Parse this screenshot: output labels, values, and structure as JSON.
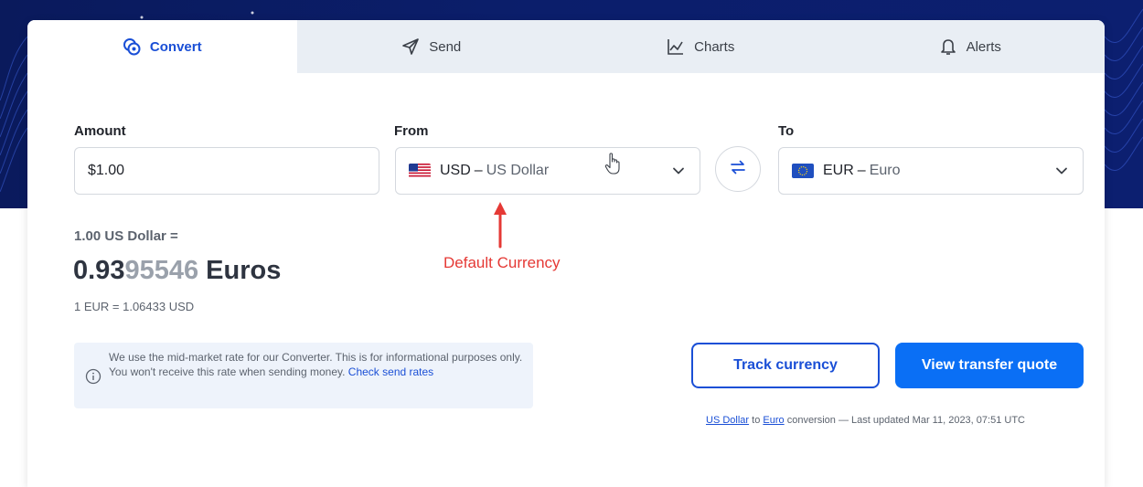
{
  "tabs": [
    {
      "label": "Convert",
      "icon": "coins-icon",
      "active": true
    },
    {
      "label": "Send",
      "icon": "paper-plane-icon",
      "active": false
    },
    {
      "label": "Charts",
      "icon": "line-chart-icon",
      "active": false
    },
    {
      "label": "Alerts",
      "icon": "bell-icon",
      "active": false
    }
  ],
  "amount": {
    "label": "Amount",
    "value": "$1.00"
  },
  "from": {
    "label": "From",
    "code": "USD",
    "separator": "–",
    "name": "US Dollar",
    "flag": "us-flag"
  },
  "to": {
    "label": "To",
    "code": "EUR",
    "separator": "–",
    "name": "Euro",
    "flag": "eu-flag"
  },
  "result": {
    "pre": "1.00 US Dollar =",
    "main_strong": "0.93",
    "main_faded": "95546",
    "main_unit": " Euros",
    "inverse": "1 EUR = 1.06433 USD"
  },
  "annotation": "Default Currency",
  "info": {
    "text": "We use the mid-market rate for our Converter. This is for informational purposes only. You won't receive this rate when sending money.",
    "link": "Check send rates"
  },
  "buttons": {
    "track": "Track currency",
    "quote": "View transfer quote"
  },
  "footnote": {
    "from_link": "US Dollar",
    "to_word": "to",
    "to_link": "Euro",
    "rest": "conversion — Last updated Mar 11, 2023, 07:51 UTC"
  },
  "colors": {
    "accent": "#1a4fd6",
    "primary_button": "#0a6ff5",
    "annotation": "#e53935",
    "hero": "#0b1e6b"
  }
}
